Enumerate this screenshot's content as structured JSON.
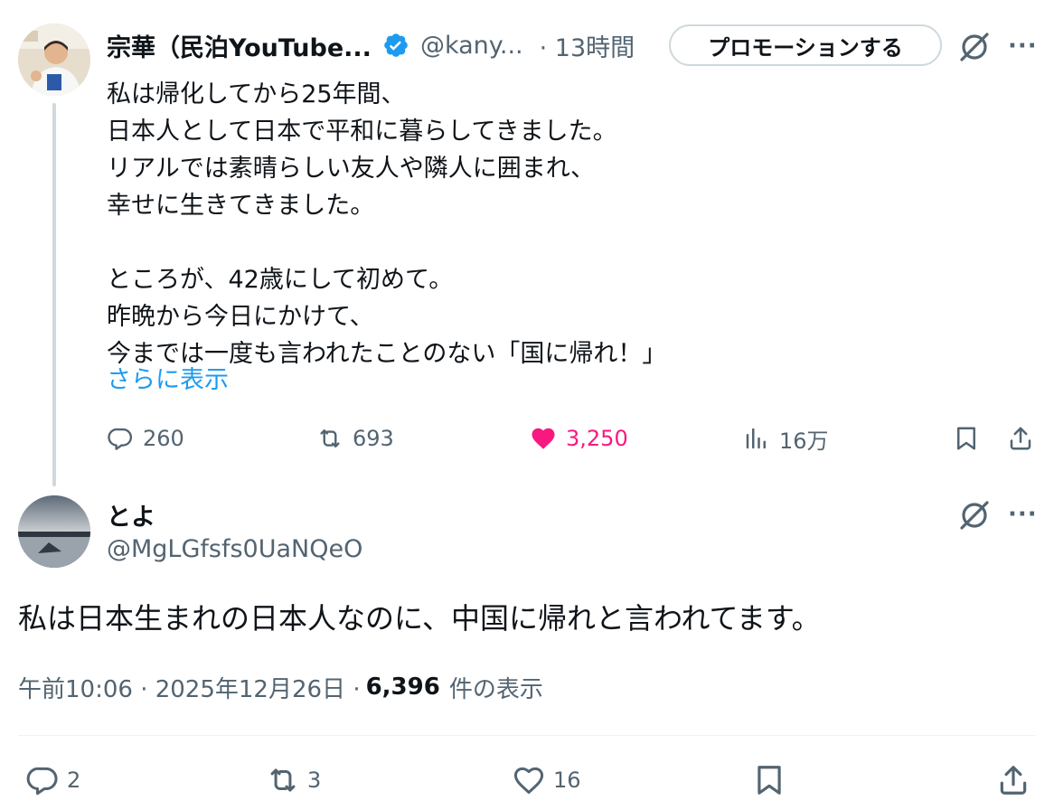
{
  "parent_tweet": {
    "author_name": "宗華（民泊YouTube...",
    "handle": "@kany...",
    "time": "· 13時間",
    "promote_label": "プロモーションする",
    "more_label": "···",
    "body_lines": [
      "私は帰化してから25年間、",
      "日本人として日本で平和に暮らしてきました。",
      "リアルでは素晴らしい友人や隣人に囲まれ、",
      "幸せに生きてきました。",
      "",
      "ところが、42歳にして初めて。",
      "昨晩から今日にかけて、",
      "今までは一度も言われたことのない「国に帰れ！」"
    ],
    "show_more": "さらに表示",
    "replies": "260",
    "reposts": "693",
    "likes": "3,250",
    "views": "16万",
    "liked": true,
    "colors": {
      "like": "#f91880",
      "link": "#1d9bf0",
      "verified": "#1d9bf0"
    }
  },
  "focused_tweet": {
    "author_name": "とよ",
    "handle": "@MgLGfsfs0UaNQeO",
    "more_label": "···",
    "body": "私は日本生まれの日本人なのに、中国に帰れと言われてます。",
    "timestamp": "午前10:06 · 2025年12月26日 · ",
    "views_count": "6,396",
    "views_label": "件の表示",
    "replies": "2",
    "reposts": "3",
    "likes": "16"
  },
  "icons": {
    "verified": "verified-badge-icon",
    "grok": "grok-icon",
    "reply": "reply-icon",
    "repost": "repost-icon",
    "like": "heart-icon",
    "views": "views-chart-icon",
    "bookmark": "bookmark-icon",
    "share": "share-icon"
  }
}
